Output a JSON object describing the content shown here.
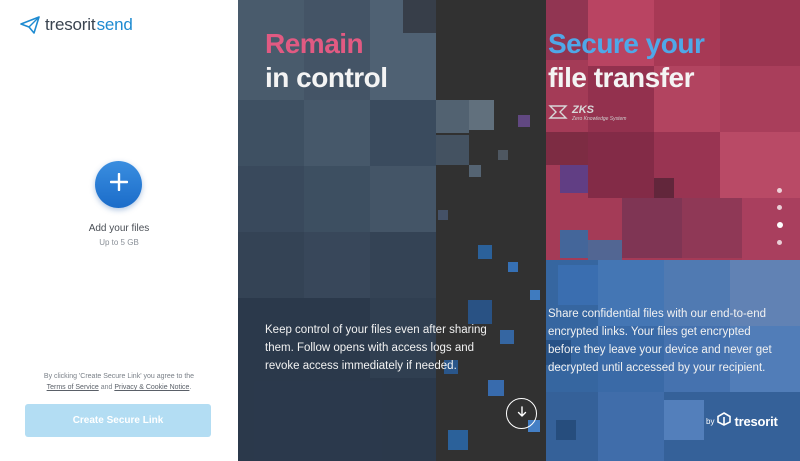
{
  "app": {
    "logo_main": "tresorit",
    "logo_accent": "send"
  },
  "upload": {
    "add_label": "Add your files",
    "limit": "Up to 5 GB"
  },
  "terms": {
    "prefix": "By clicking 'Create Secure Link' you agree to the",
    "tos": "Terms of Service",
    "and": "and",
    "privacy": "Privacy & Cookie Notice",
    "suffix": "."
  },
  "actions": {
    "create_link": "Create Secure Link"
  },
  "hero": {
    "title1_line1": "Remain",
    "title1_line2": "in control",
    "desc1": "Keep control of your files even after sharing them. Follow opens with access logs and revoke access immediately if needed.",
    "title2_line1": "Secure your",
    "title2_line2": "file transfer",
    "zks_label": "ZKS",
    "zks_sub": "Zero Knowledge System",
    "desc2": "Share confidential files with our end-to-end encrypted links. Your files get encrypted before they leave your device and never get decrypted until accessed by your recipient.",
    "by": "by",
    "brand": "tresorit",
    "slides": {
      "count": 4,
      "active_index": 2
    }
  },
  "colors": {
    "accent_blue": "#1e8bd1",
    "pink": "#e15a82",
    "light_blue": "#4fa8e8",
    "button_disabled": "#b3ddf3"
  },
  "icons": [
    "paper-plane-icon",
    "plus-icon",
    "arrow-down-icon",
    "tresorit-logo-icon",
    "zks-icon"
  ]
}
